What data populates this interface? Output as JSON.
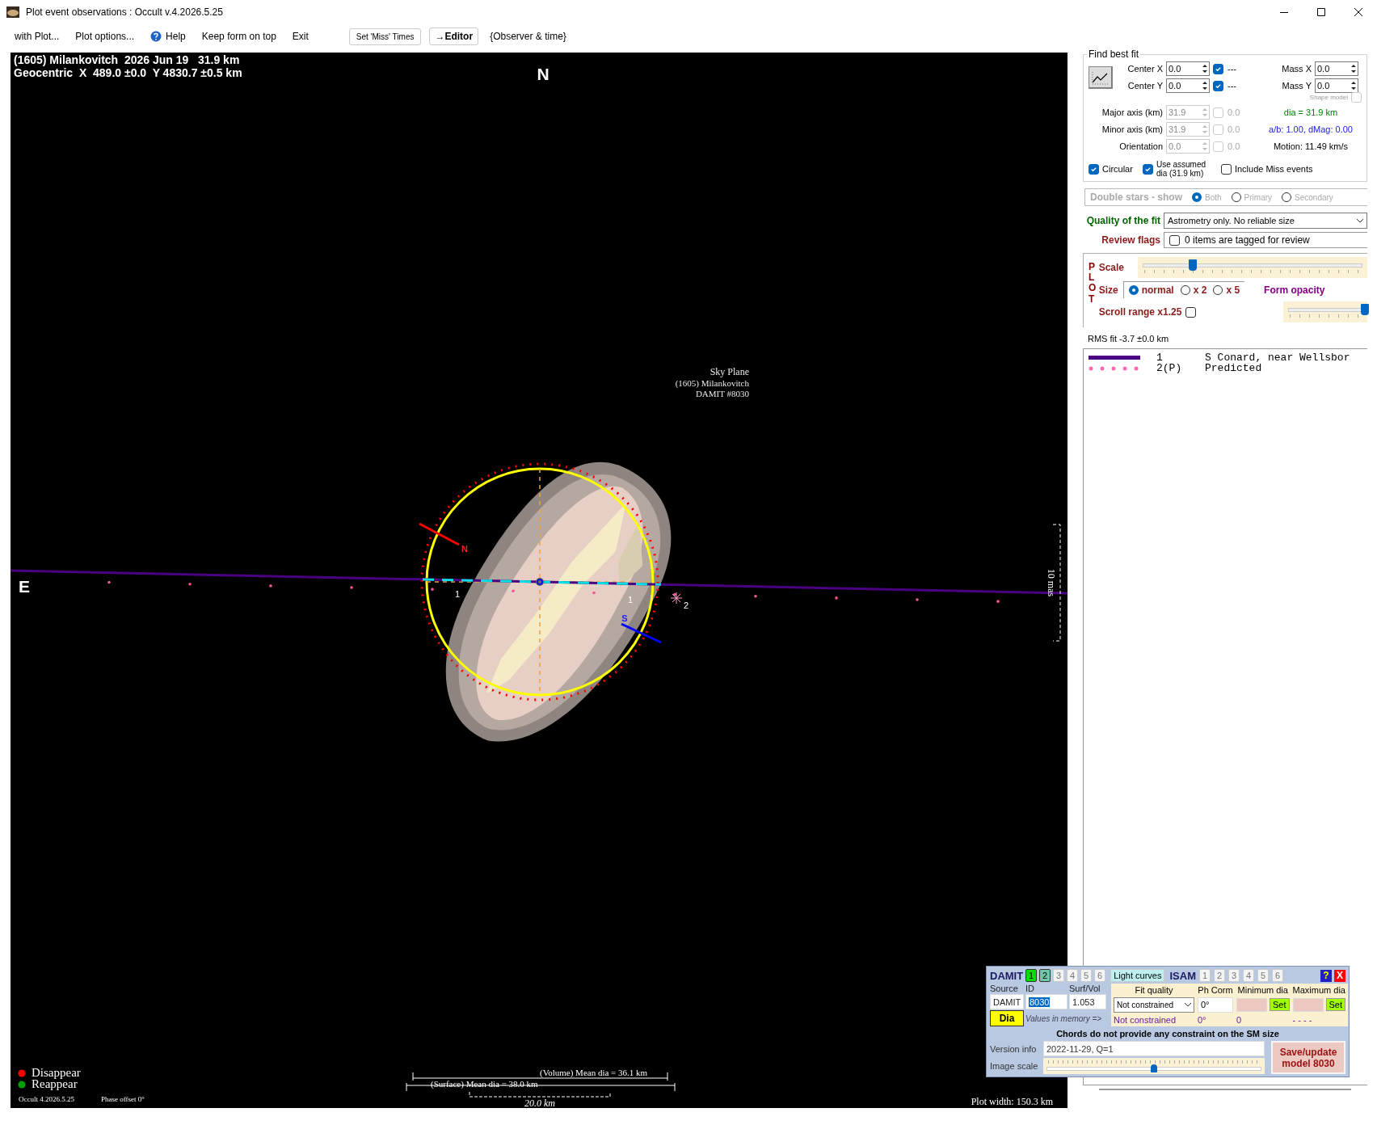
{
  "window": {
    "title": "Plot event observations : Occult v.4.2026.5.25"
  },
  "menu": [
    {
      "label": "with Plot...",
      "kind": "menu"
    },
    {
      "label": "Plot options...",
      "kind": "menu"
    },
    {
      "label": "Help",
      "kind": "help"
    },
    {
      "label": "Keep form on top",
      "kind": "menu"
    },
    {
      "label": "Exit",
      "kind": "menu"
    },
    {
      "label": "Set 'Miss' Times",
      "kind": "button"
    },
    {
      "label": "→Editor",
      "kind": "strong-button"
    },
    {
      "label": "{Observer & time}",
      "kind": "menu"
    }
  ],
  "plot": {
    "title": "(1605) Milankovitch  2026 Jun 19   31.9 km",
    "subtitle": "Geocentric  X  489.0 ±0.0  Y 4830.7 ±0.5 km",
    "north": "N",
    "east": "E",
    "sky_plane": [
      "Sky Plane",
      "(1605) Milankovitch",
      "DAMIT #8030"
    ],
    "pole_north": "N",
    "pole_south": "S",
    "chord_labels": [
      "1",
      "1"
    ],
    "star_label": "2",
    "scale_label": "10 mas",
    "events": [
      {
        "label": "Disappear",
        "color": "#ff0000"
      },
      {
        "label": "Reappear",
        "color": "#00a000"
      }
    ],
    "version": "Occult 4.2026.5.25",
    "phase_offset": "Phase offset 0°",
    "volume_dia": "(Volume) Mean dia = 36.1 km",
    "surface_dia": "(Surface) Mean dia = 38.0 km",
    "scale_bar": "20.0 km",
    "plot_width": "Plot width: 150.3 km"
  },
  "fit": {
    "title": "Find best fit",
    "centers": [
      {
        "label": "Center X",
        "value": "0.0",
        "checked": true,
        "flag": "---"
      },
      {
        "label": "Center Y",
        "value": "0.0",
        "checked": true,
        "flag": "---"
      }
    ],
    "mass": [
      {
        "label": "Mass X",
        "value": "0.0"
      },
      {
        "label": "Mass Y",
        "value": "0.0"
      }
    ],
    "shape_model": {
      "label": "Shape model",
      "checked": false
    },
    "axes": [
      {
        "label": "Major axis (km)",
        "value": "31.9",
        "checked": false,
        "flag": "0.0",
        "disabled": true
      },
      {
        "label": "Minor axis (km)",
        "value": "31.9",
        "checked": false,
        "flag": "0.0",
        "disabled": true
      },
      {
        "label": "Orientation",
        "value": "0.0",
        "checked": false,
        "flag": "0.0",
        "disabled": true
      }
    ],
    "dia": "dia = 31.9 km",
    "ratio": "a/b: 1.00, dMag: 0.00",
    "motion": "Motion: 11.49 km/s",
    "options": [
      {
        "label": "Circular",
        "checked": true
      },
      {
        "label": "Use assumed dia (31.9 km)",
        "checked": true
      },
      {
        "label": "Include Miss events",
        "checked": false
      }
    ]
  },
  "double_stars": {
    "label": "Double stars - show",
    "disabled": true,
    "options": [
      {
        "label": "Both",
        "selected": true
      },
      {
        "label": "Primary",
        "selected": false
      },
      {
        "label": "Secondary",
        "selected": false
      }
    ]
  },
  "quality": {
    "label": "Quality of the fit",
    "value": "Astrometry only. No reliable size"
  },
  "review": {
    "label": "Review flags",
    "checked": false,
    "text": "0 items are tagged for review"
  },
  "plot_options": {
    "title": "PLOT",
    "scale": {
      "label": "Scale",
      "level": 0.24
    },
    "size": {
      "label": "Size",
      "options": [
        {
          "label": "normal",
          "selected": true
        },
        {
          "label": "x 2",
          "selected": false
        },
        {
          "label": "x 5",
          "selected": false
        }
      ]
    },
    "scroll": {
      "label": "Scroll range x1.25",
      "checked": false
    },
    "opacity": {
      "label": "Form opacity",
      "level": 0.97
    }
  },
  "rms": "RMS fit -3.7 ±0.0 km",
  "observers": [
    {
      "kind": "line",
      "number": "1",
      "name": "S Conard, near Wellsbor",
      "color": "#4b0082"
    },
    {
      "kind": "dots",
      "number": "2(P)",
      "name": "Predicted",
      "color": "#ff69b4"
    }
  ],
  "damit": {
    "label": "DAMIT",
    "tabs": [
      {
        "label": "1",
        "selected": true,
        "disabled": false
      },
      {
        "label": "2",
        "selected": false,
        "disabled": false
      },
      {
        "label": "3",
        "selected": false,
        "disabled": true
      },
      {
        "label": "4",
        "selected": false,
        "disabled": true
      },
      {
        "label": "5",
        "selected": false,
        "disabled": true
      },
      {
        "label": "6",
        "selected": false,
        "disabled": true
      }
    ],
    "light_curves": "Light curves",
    "isam_label": "ISAM",
    "isam_tabs": [
      {
        "label": "1",
        "selected": false,
        "disabled": true
      },
      {
        "label": "2",
        "selected": false,
        "disabled": true
      },
      {
        "label": "3",
        "selected": false,
        "disabled": true
      },
      {
        "label": "4",
        "selected": false,
        "disabled": true
      },
      {
        "label": "5",
        "selected": false,
        "disabled": true
      },
      {
        "label": "6",
        "selected": false,
        "disabled": true
      }
    ],
    "help": "?",
    "close": "X",
    "columns": [
      "Source",
      "ID",
      "Surf/Vol"
    ],
    "source": "DAMIT",
    "id": "8030",
    "surf_vol": "1.053",
    "dia_button": "Dia",
    "memory_label": "Values in memory =>",
    "fit_headers": [
      "Fit quality",
      "Ph Corm",
      "Minimum dia",
      "Maximum dia"
    ],
    "fit_quality": "Not constrained",
    "ph_corr": "0°",
    "set_buttons": [
      "Set",
      "Set"
    ],
    "memory": [
      "Not constrained",
      "0°",
      "0",
      "- - - -"
    ],
    "message": "Chords do not provide any constraint on the SM size",
    "version_label": "Version info",
    "version": "2022-11-29, Q=1",
    "image_scale": {
      "label": "Image scale",
      "level": 0.5
    },
    "save": "Save/update model 8030"
  }
}
